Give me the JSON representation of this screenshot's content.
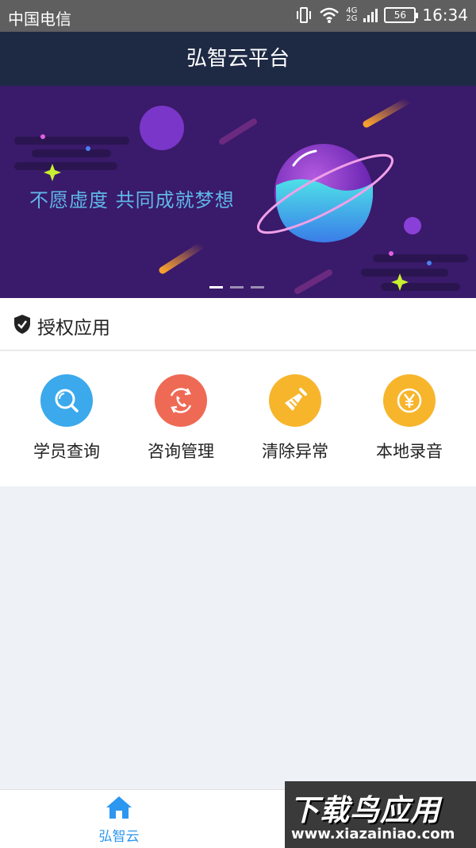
{
  "status_bar": {
    "carrier": "中国电信",
    "network_top": "4G",
    "network_bottom": "2G",
    "battery": "56",
    "time": "16:34"
  },
  "app_bar": {
    "title": "弘智云平台"
  },
  "banner": {
    "slogan": "不愿虚度  共同成就梦想",
    "page_count": 3,
    "active_page": 1
  },
  "section": {
    "title": "授权应用"
  },
  "apps": [
    {
      "label": "学员查询",
      "icon": "search-icon",
      "color": "#3ba9ec"
    },
    {
      "label": "咨询管理",
      "icon": "phone-refresh-icon",
      "color": "#ef6a55"
    },
    {
      "label": "清除异常",
      "icon": "broom-icon",
      "color": "#f7b52c"
    },
    {
      "label": "本地录音",
      "icon": "yen-coin-icon",
      "color": "#f7b52c"
    }
  ],
  "tab_bar": {
    "home_label": "弘智云",
    "accent": "#2c97f0"
  },
  "watermark": {
    "big": "下载鸟应用",
    "small": "www.xiazainiao.com"
  }
}
